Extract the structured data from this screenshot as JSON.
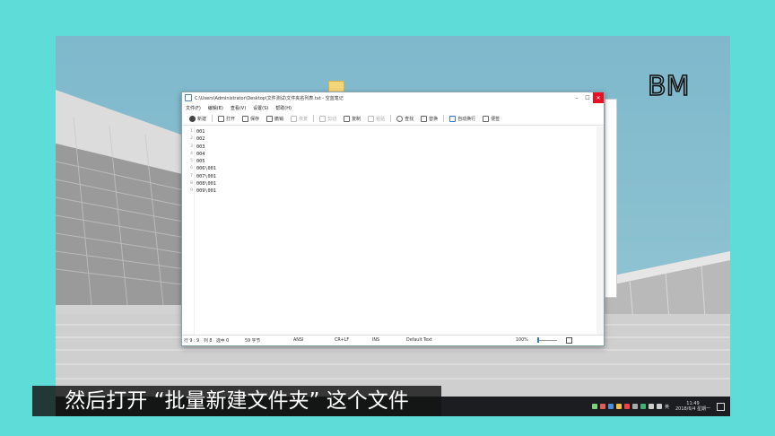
{
  "window": {
    "title": "C:\\Users\\Administrator\\Desktop\\文件测试\\文件夹名列表.txt - 空蓝笔记",
    "minimize_glyph": "–",
    "maximize_glyph": "☐",
    "close_glyph": "✕"
  },
  "menu": [
    "文件(F)",
    "编辑(E)",
    "查看(V)",
    "设置(S)",
    "帮助(H)"
  ],
  "toolbar": [
    {
      "label": "新建",
      "icon": "new-file-icon",
      "enabled": true
    },
    {
      "label": "打开",
      "icon": "open-folder-icon",
      "enabled": true
    },
    {
      "label": "保存",
      "icon": "save-icon",
      "enabled": true
    },
    {
      "label": "撤销",
      "icon": "undo-icon",
      "enabled": true
    },
    {
      "label": "恢复",
      "icon": "redo-icon",
      "enabled": false
    },
    {
      "label": "剪切",
      "icon": "cut-icon",
      "enabled": false
    },
    {
      "label": "复制",
      "icon": "copy-icon",
      "enabled": true
    },
    {
      "label": "粘贴",
      "icon": "paste-icon",
      "enabled": false
    },
    {
      "label": "查找",
      "icon": "find-icon",
      "enabled": true
    },
    {
      "label": "替换",
      "icon": "replace-icon",
      "enabled": true
    },
    {
      "label": "自动换行",
      "icon": "wrap-icon",
      "enabled": true
    },
    {
      "label": "便签",
      "icon": "note-icon",
      "enabled": true
    }
  ],
  "editor": {
    "line_numbers": [
      "1",
      "2",
      "3",
      "4",
      "5",
      "6",
      "7",
      "8",
      "9"
    ],
    "lines": [
      "001",
      "002",
      "003",
      "004",
      "005",
      "006\\001",
      "007\\001",
      "008\\001",
      "009\\001"
    ]
  },
  "statusbar": {
    "position": "行 9 : 9",
    "column": "列 8",
    "selection": "选中 0",
    "size": "59 字节",
    "encoding": "ANSI",
    "line_ending": "CR+LF",
    "mode": "INS",
    "font": "Default Text",
    "zoom": "100%"
  },
  "taskbar": {
    "time": "11:49",
    "date": "2018/6/4 星期一",
    "ime": "英"
  },
  "logo_text": "BM",
  "subtitle": "然后打开 “批量新建文件夹” 这个文件",
  "colors": {
    "close_button": "#e81123",
    "accent": "#2d7bd6",
    "desktop_bg": "#5edcd7"
  }
}
